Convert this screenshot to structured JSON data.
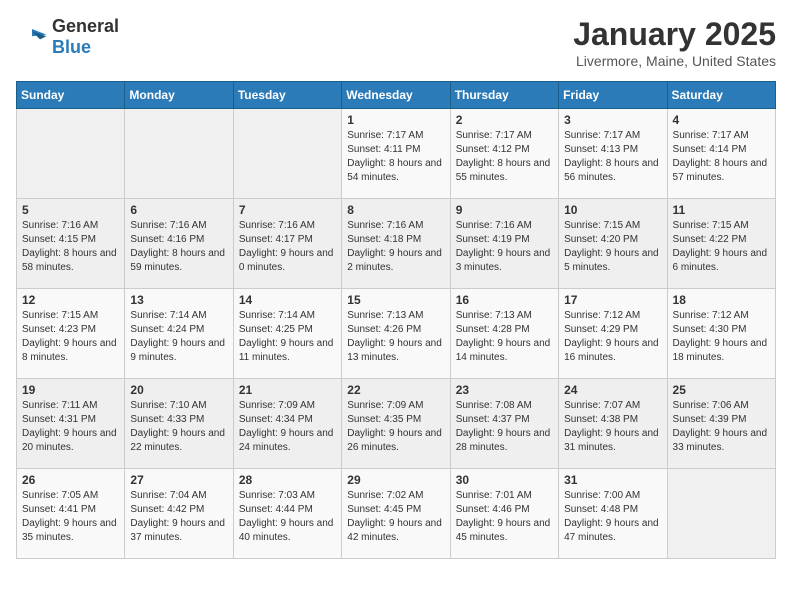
{
  "header": {
    "logo_general": "General",
    "logo_blue": "Blue",
    "title": "January 2025",
    "subtitle": "Livermore, Maine, United States"
  },
  "days_of_week": [
    "Sunday",
    "Monday",
    "Tuesday",
    "Wednesday",
    "Thursday",
    "Friday",
    "Saturday"
  ],
  "weeks": [
    [
      {
        "day": "",
        "sunrise": "",
        "sunset": "",
        "daylight": ""
      },
      {
        "day": "",
        "sunrise": "",
        "sunset": "",
        "daylight": ""
      },
      {
        "day": "",
        "sunrise": "",
        "sunset": "",
        "daylight": ""
      },
      {
        "day": "1",
        "sunrise": "Sunrise: 7:17 AM",
        "sunset": "Sunset: 4:11 PM",
        "daylight": "Daylight: 8 hours and 54 minutes."
      },
      {
        "day": "2",
        "sunrise": "Sunrise: 7:17 AM",
        "sunset": "Sunset: 4:12 PM",
        "daylight": "Daylight: 8 hours and 55 minutes."
      },
      {
        "day": "3",
        "sunrise": "Sunrise: 7:17 AM",
        "sunset": "Sunset: 4:13 PM",
        "daylight": "Daylight: 8 hours and 56 minutes."
      },
      {
        "day": "4",
        "sunrise": "Sunrise: 7:17 AM",
        "sunset": "Sunset: 4:14 PM",
        "daylight": "Daylight: 8 hours and 57 minutes."
      }
    ],
    [
      {
        "day": "5",
        "sunrise": "Sunrise: 7:16 AM",
        "sunset": "Sunset: 4:15 PM",
        "daylight": "Daylight: 8 hours and 58 minutes."
      },
      {
        "day": "6",
        "sunrise": "Sunrise: 7:16 AM",
        "sunset": "Sunset: 4:16 PM",
        "daylight": "Daylight: 8 hours and 59 minutes."
      },
      {
        "day": "7",
        "sunrise": "Sunrise: 7:16 AM",
        "sunset": "Sunset: 4:17 PM",
        "daylight": "Daylight: 9 hours and 0 minutes."
      },
      {
        "day": "8",
        "sunrise": "Sunrise: 7:16 AM",
        "sunset": "Sunset: 4:18 PM",
        "daylight": "Daylight: 9 hours and 2 minutes."
      },
      {
        "day": "9",
        "sunrise": "Sunrise: 7:16 AM",
        "sunset": "Sunset: 4:19 PM",
        "daylight": "Daylight: 9 hours and 3 minutes."
      },
      {
        "day": "10",
        "sunrise": "Sunrise: 7:15 AM",
        "sunset": "Sunset: 4:20 PM",
        "daylight": "Daylight: 9 hours and 5 minutes."
      },
      {
        "day": "11",
        "sunrise": "Sunrise: 7:15 AM",
        "sunset": "Sunset: 4:22 PM",
        "daylight": "Daylight: 9 hours and 6 minutes."
      }
    ],
    [
      {
        "day": "12",
        "sunrise": "Sunrise: 7:15 AM",
        "sunset": "Sunset: 4:23 PM",
        "daylight": "Daylight: 9 hours and 8 minutes."
      },
      {
        "day": "13",
        "sunrise": "Sunrise: 7:14 AM",
        "sunset": "Sunset: 4:24 PM",
        "daylight": "Daylight: 9 hours and 9 minutes."
      },
      {
        "day": "14",
        "sunrise": "Sunrise: 7:14 AM",
        "sunset": "Sunset: 4:25 PM",
        "daylight": "Daylight: 9 hours and 11 minutes."
      },
      {
        "day": "15",
        "sunrise": "Sunrise: 7:13 AM",
        "sunset": "Sunset: 4:26 PM",
        "daylight": "Daylight: 9 hours and 13 minutes."
      },
      {
        "day": "16",
        "sunrise": "Sunrise: 7:13 AM",
        "sunset": "Sunset: 4:28 PM",
        "daylight": "Daylight: 9 hours and 14 minutes."
      },
      {
        "day": "17",
        "sunrise": "Sunrise: 7:12 AM",
        "sunset": "Sunset: 4:29 PM",
        "daylight": "Daylight: 9 hours and 16 minutes."
      },
      {
        "day": "18",
        "sunrise": "Sunrise: 7:12 AM",
        "sunset": "Sunset: 4:30 PM",
        "daylight": "Daylight: 9 hours and 18 minutes."
      }
    ],
    [
      {
        "day": "19",
        "sunrise": "Sunrise: 7:11 AM",
        "sunset": "Sunset: 4:31 PM",
        "daylight": "Daylight: 9 hours and 20 minutes."
      },
      {
        "day": "20",
        "sunrise": "Sunrise: 7:10 AM",
        "sunset": "Sunset: 4:33 PM",
        "daylight": "Daylight: 9 hours and 22 minutes."
      },
      {
        "day": "21",
        "sunrise": "Sunrise: 7:09 AM",
        "sunset": "Sunset: 4:34 PM",
        "daylight": "Daylight: 9 hours and 24 minutes."
      },
      {
        "day": "22",
        "sunrise": "Sunrise: 7:09 AM",
        "sunset": "Sunset: 4:35 PM",
        "daylight": "Daylight: 9 hours and 26 minutes."
      },
      {
        "day": "23",
        "sunrise": "Sunrise: 7:08 AM",
        "sunset": "Sunset: 4:37 PM",
        "daylight": "Daylight: 9 hours and 28 minutes."
      },
      {
        "day": "24",
        "sunrise": "Sunrise: 7:07 AM",
        "sunset": "Sunset: 4:38 PM",
        "daylight": "Daylight: 9 hours and 31 minutes."
      },
      {
        "day": "25",
        "sunrise": "Sunrise: 7:06 AM",
        "sunset": "Sunset: 4:39 PM",
        "daylight": "Daylight: 9 hours and 33 minutes."
      }
    ],
    [
      {
        "day": "26",
        "sunrise": "Sunrise: 7:05 AM",
        "sunset": "Sunset: 4:41 PM",
        "daylight": "Daylight: 9 hours and 35 minutes."
      },
      {
        "day": "27",
        "sunrise": "Sunrise: 7:04 AM",
        "sunset": "Sunset: 4:42 PM",
        "daylight": "Daylight: 9 hours and 37 minutes."
      },
      {
        "day": "28",
        "sunrise": "Sunrise: 7:03 AM",
        "sunset": "Sunset: 4:44 PM",
        "daylight": "Daylight: 9 hours and 40 minutes."
      },
      {
        "day": "29",
        "sunrise": "Sunrise: 7:02 AM",
        "sunset": "Sunset: 4:45 PM",
        "daylight": "Daylight: 9 hours and 42 minutes."
      },
      {
        "day": "30",
        "sunrise": "Sunrise: 7:01 AM",
        "sunset": "Sunset: 4:46 PM",
        "daylight": "Daylight: 9 hours and 45 minutes."
      },
      {
        "day": "31",
        "sunrise": "Sunrise: 7:00 AM",
        "sunset": "Sunset: 4:48 PM",
        "daylight": "Daylight: 9 hours and 47 minutes."
      },
      {
        "day": "",
        "sunrise": "",
        "sunset": "",
        "daylight": ""
      }
    ]
  ]
}
